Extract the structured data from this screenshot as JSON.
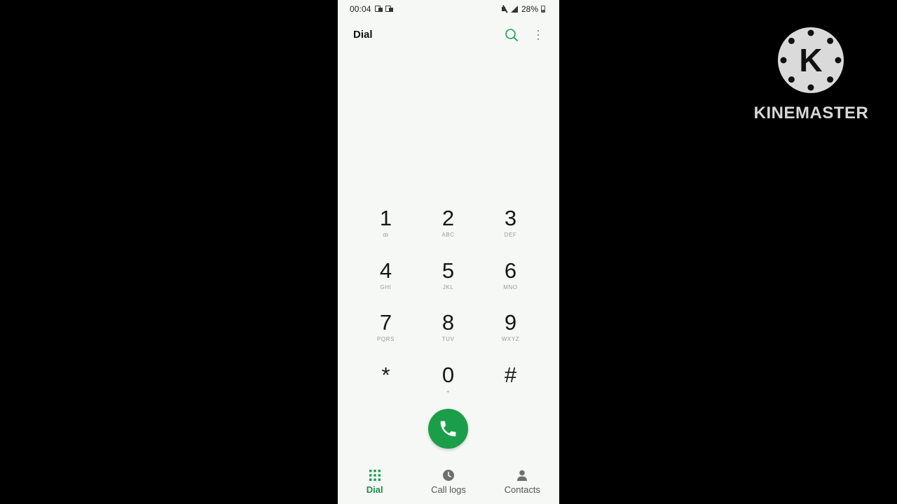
{
  "status_bar": {
    "time": "00:04",
    "battery": "28%"
  },
  "app_bar": {
    "title": "Dial"
  },
  "keypad": [
    {
      "digit": "1",
      "letters": "ꝏ"
    },
    {
      "digit": "2",
      "letters": "ABC"
    },
    {
      "digit": "3",
      "letters": "DEF"
    },
    {
      "digit": "4",
      "letters": "GHI"
    },
    {
      "digit": "5",
      "letters": "JKL"
    },
    {
      "digit": "6",
      "letters": "MNO"
    },
    {
      "digit": "7",
      "letters": "PQRS"
    },
    {
      "digit": "8",
      "letters": "TUV"
    },
    {
      "digit": "9",
      "letters": "WXYZ"
    },
    {
      "digit": "*",
      "letters": ""
    },
    {
      "digit": "0",
      "letters": "+"
    },
    {
      "digit": "#",
      "letters": ""
    }
  ],
  "bottom_nav": [
    {
      "label": "Dial",
      "icon": "dialpad-icon",
      "active": true
    },
    {
      "label": "Call logs",
      "icon": "clock-icon",
      "active": false
    },
    {
      "label": "Contacts",
      "icon": "person-icon",
      "active": false
    }
  ],
  "watermark": {
    "text": "KINEMASTER",
    "logo_letter": "K"
  },
  "colors": {
    "accent": "#1b9e49",
    "background": "#f6f8f5"
  }
}
